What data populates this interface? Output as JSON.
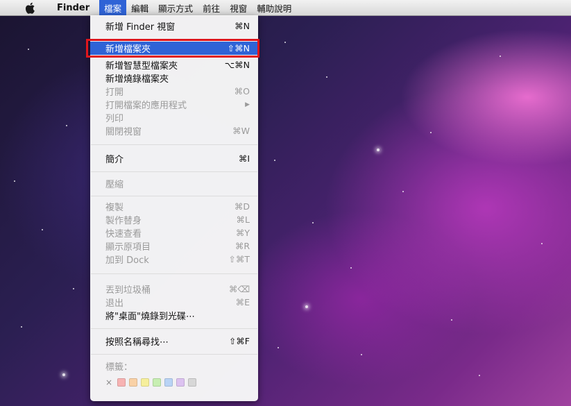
{
  "menubar": {
    "app": "Finder",
    "items": [
      "檔案",
      "編輯",
      "顯示方式",
      "前往",
      "視窗",
      "輔助說明"
    ]
  },
  "menu": {
    "items": [
      {
        "label": "新增 Finder 視窗",
        "shortcut": "⌘N"
      },
      {
        "label": "新增檔案夾",
        "shortcut": "⇧⌘N"
      },
      {
        "label": "新增智慧型檔案夾",
        "shortcut": "⌥⌘N"
      },
      {
        "label": "新增燒錄檔案夾",
        "shortcut": ""
      },
      {
        "label": "打開",
        "shortcut": "⌘O"
      },
      {
        "label": "打開檔案的應用程式",
        "shortcut": "▶"
      },
      {
        "label": "列印",
        "shortcut": ""
      },
      {
        "label": "關閉視窗",
        "shortcut": "⌘W"
      },
      {
        "label": "簡介",
        "shortcut": "⌘I"
      },
      {
        "label": "壓縮",
        "shortcut": ""
      },
      {
        "label": "複製",
        "shortcut": "⌘D"
      },
      {
        "label": "製作替身",
        "shortcut": "⌘L"
      },
      {
        "label": "快速查看",
        "shortcut": "⌘Y"
      },
      {
        "label": "顯示原項目",
        "shortcut": "⌘R"
      },
      {
        "label": "加到 Dock",
        "shortcut": "⇧⌘T"
      },
      {
        "label": "丟到垃圾桶",
        "shortcut": "⌘⌫"
      },
      {
        "label": "退出",
        "shortcut": "⌘E"
      },
      {
        "label": "將\"桌面\"燒錄到光碟⋯",
        "shortcut": ""
      },
      {
        "label": "按照名稱尋找⋯",
        "shortcut": "⇧⌘F"
      },
      {
        "label": "標籤：",
        "shortcut": ""
      }
    ],
    "tag_remove": "×",
    "tag_colors": [
      "#f7b3b3",
      "#f9d1a6",
      "#f6ef9c",
      "#c7eeb2",
      "#b9d3f5",
      "#dcc2f0",
      "#d7d7d7"
    ]
  },
  "colors": {
    "selection": "#2f63d6",
    "annotation": "#e0161c"
  }
}
